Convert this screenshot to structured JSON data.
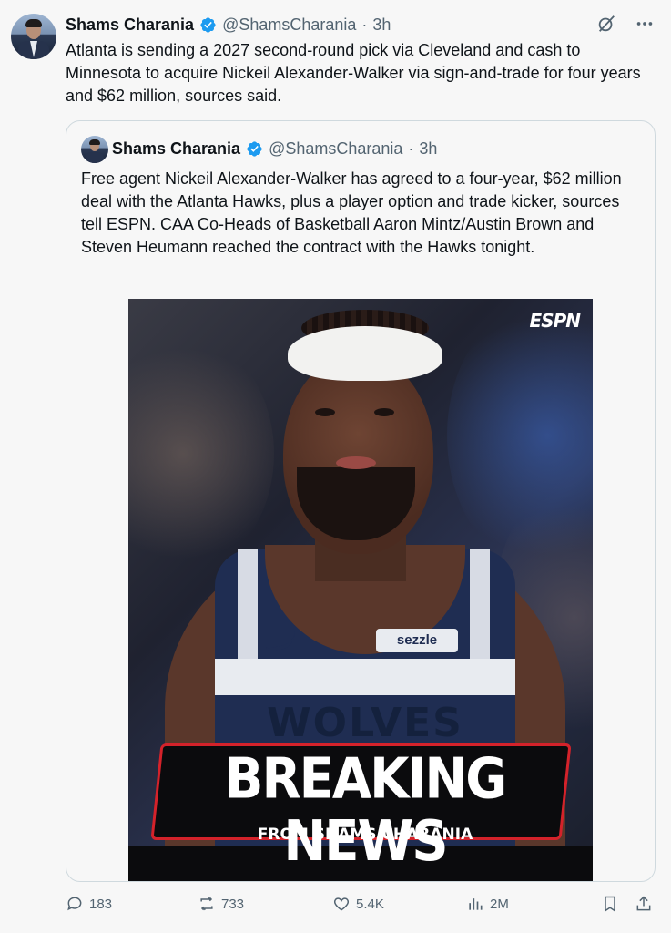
{
  "tweet": {
    "author_name": "Shams Charania",
    "handle": "@ShamsCharania",
    "separator": "·",
    "time": "3h",
    "text": "Atlanta is sending a 2027 second-round pick via Cleveland and cash to Minnesota to acquire Nickeil Alexander-Walker via sign-and-trade for four years and $62 million, sources said."
  },
  "quoted": {
    "author_name": "Shams Charania",
    "handle": "@ShamsCharania",
    "separator": "·",
    "time": "3h",
    "text": "Free agent Nickeil Alexander-Walker has agreed to a four-year, $62 million deal with the Atlanta Hawks, plus a player option and trade kicker, sources tell ESPN. CAA Co-Heads of Basketball Aaron Mintz/Austin Brown and Steven Heumann reached the contract with the Hawks tonight.",
    "image": {
      "brand": "ESPN",
      "jersey_sponsor": "sezzle",
      "jersey_text": "WOLVES",
      "headline": "BREAKING NEWS",
      "subline": "FROM SHAMS CHARANIA"
    }
  },
  "actions": {
    "replies": "183",
    "reposts": "733",
    "likes": "5.4K",
    "views": "2M"
  },
  "icons": [
    "verified-badge-icon",
    "grok-icon",
    "more-icon",
    "reply-icon",
    "repost-icon",
    "like-icon",
    "views-icon",
    "bookmark-icon",
    "share-icon"
  ],
  "colors": {
    "verified": "#1d9bf0",
    "muted": "#536471",
    "border": "#cfd9de",
    "banner_red": "#d4222a"
  }
}
